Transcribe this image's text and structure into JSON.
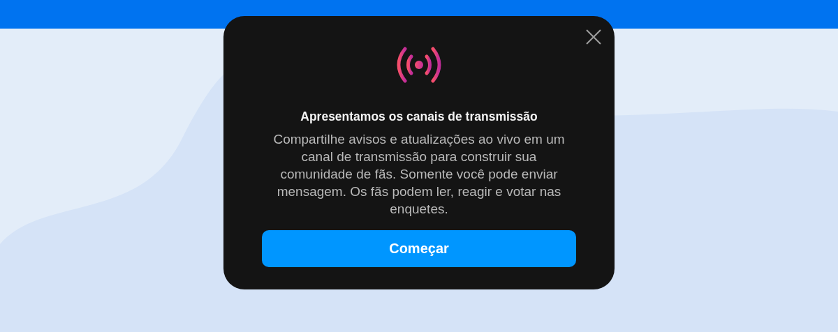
{
  "dialog": {
    "title": "Apresentamos os canais de transmissão",
    "body": "Compartilhe avisos e atualizações ao vivo em um canal de transmissão para construir sua comunidade de fãs. Somente você pode enviar mensagem. Os fãs podem ler, reagir e votar nas enquetes.",
    "button": "Começar"
  }
}
